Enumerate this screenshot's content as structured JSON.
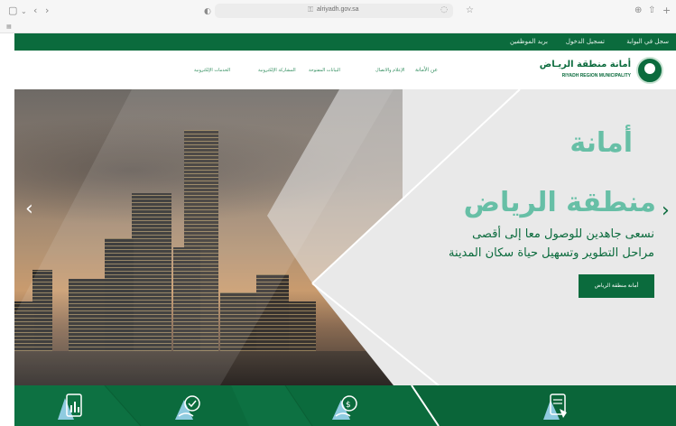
{
  "browser": {
    "url": "alriyadh.gov.sa"
  },
  "topbar": {
    "portal_log": "سجل في البوابة",
    "login": "تسجيل الدخول",
    "staff_mail": "بريد الموظفين"
  },
  "logo": {
    "arabic": "أمانة منطقة الريـاض",
    "english": "RIYADH REGION MUNICIPALITY"
  },
  "nav": {
    "about": "عن الأمانة",
    "media": "الإعلام والاتصال",
    "open_data": "البيانات المفتوحة",
    "e_participation": "المشاركة الإلكترونية",
    "e_services": "الخدمات الإلكترونية"
  },
  "hero": {
    "title_line1": "أمانة",
    "title_line2": "منطقة الرياض",
    "subtitle_line1": "نسعى جاهدين للوصول معا إلى أقصى",
    "subtitle_line2": "مراحل التطوير وتسهيل حياة سكان المدينة",
    "button_label": "أمانة منطقة الرياض",
    "prev_arrow": "‹",
    "next_arrow": "›"
  },
  "colors": {
    "brand_green": "#0b6b3d",
    "accent_teal": "#67bfa6"
  }
}
